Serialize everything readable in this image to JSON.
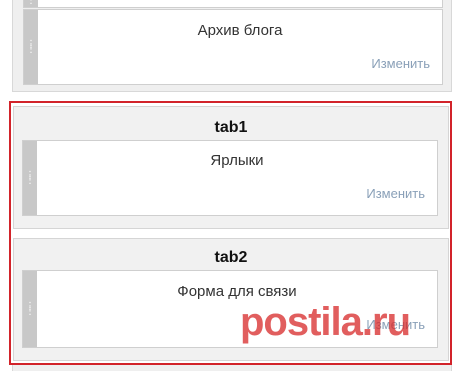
{
  "top_section": {
    "gadget_top_partial": {},
    "gadget_archive": {
      "title": "Архив блога",
      "edit_label": "Изменить"
    }
  },
  "tab1": {
    "title": "tab1",
    "gadget": {
      "title": "Ярлыки",
      "edit_label": "Изменить"
    }
  },
  "tab2": {
    "title": "tab2",
    "gadget": {
      "title": "Форма для связи",
      "edit_label": "Изменить"
    }
  },
  "watermark": {
    "text": "postila.ru"
  },
  "colors": {
    "highlight_border": "#d2232a",
    "edit_link": "#8aa0b8",
    "handle": "#c8c8c8"
  },
  "icons": {
    "drag_handle": "drag-handle-icon"
  }
}
